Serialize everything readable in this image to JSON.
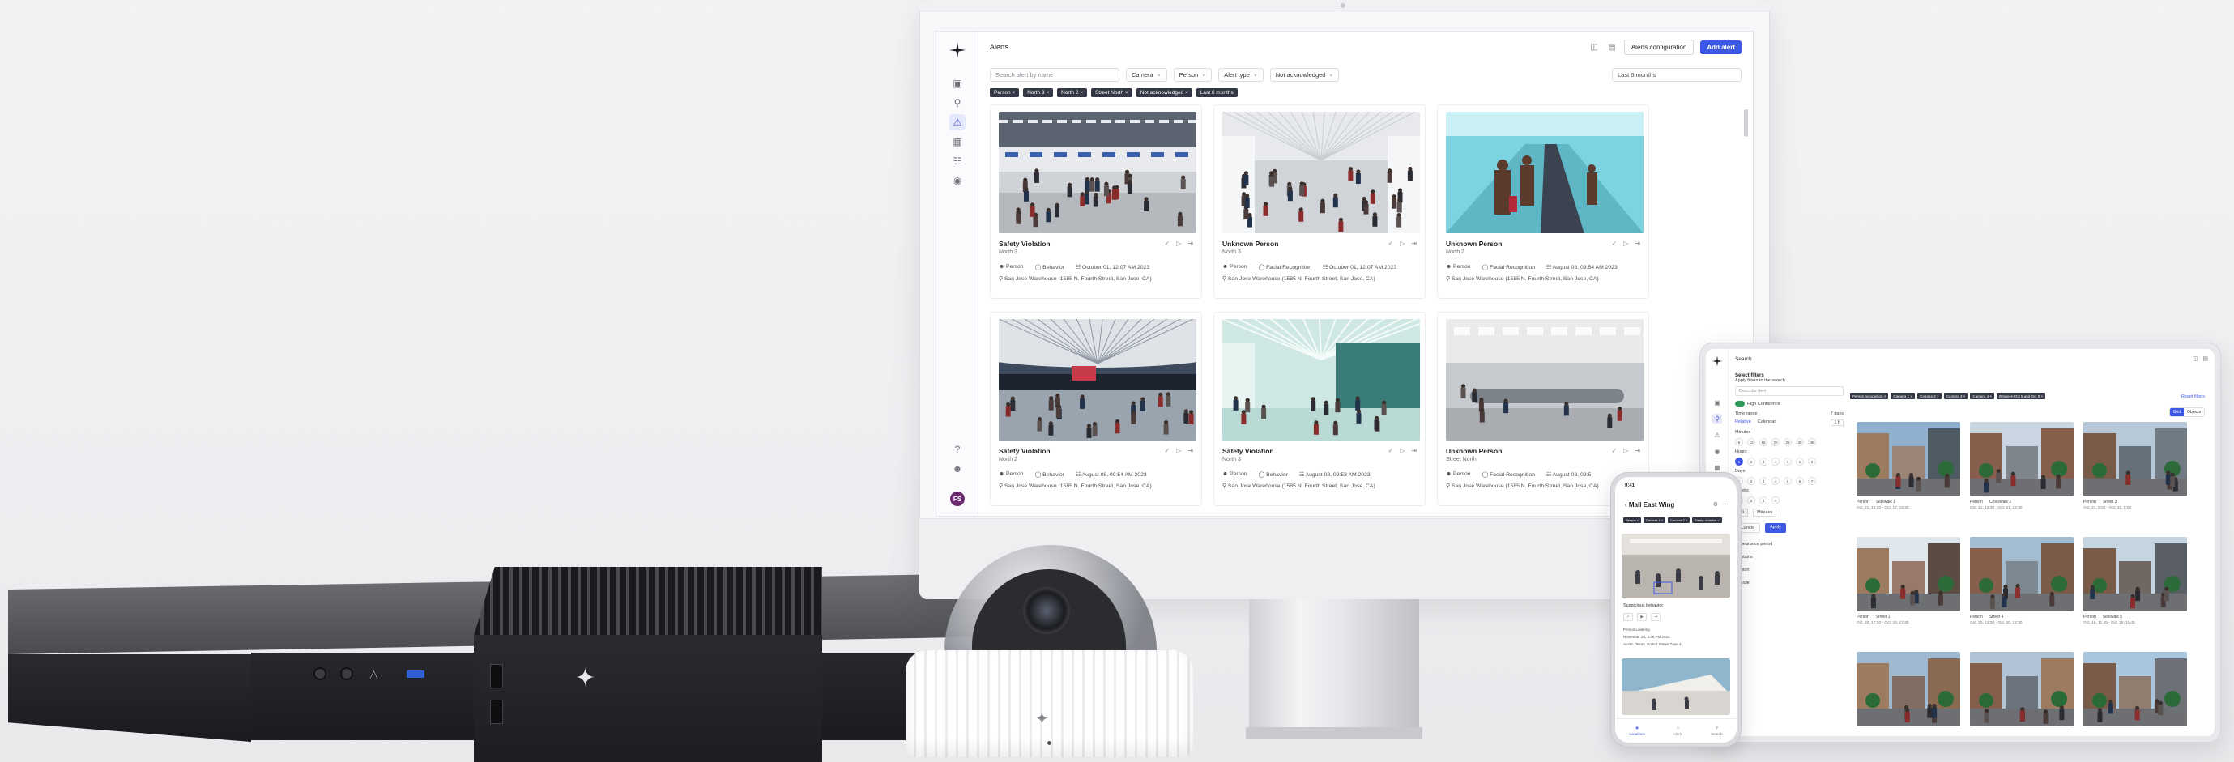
{
  "monitor": {
    "breadcrumb": "Alerts",
    "buttons": {
      "alerts_configuration": "Alerts configuration",
      "add_alert": "Add alert"
    },
    "avatar_initials": "FS",
    "search_placeholder": "Search alert by name",
    "filters": [
      "Camera",
      "Person",
      "Alert type",
      "Not acknowledged"
    ],
    "date_range": "Last 6 months",
    "chips": [
      "Person ×",
      "North 3 ×",
      "North 2 ×",
      "Street North ×",
      "Not acknowledged ×",
      "Last 6 months"
    ],
    "cards": [
      {
        "title": "Safety Violation",
        "sub": "North 3",
        "type": "Person",
        "detector": "Behavior",
        "time": "October 01, 12:07 AM 2023",
        "location": "San Jose Warehouse (1585 N. Fourth Street, San Jose, CA)",
        "scene": "checkin"
      },
      {
        "title": "Unknown Person",
        "sub": "North 3",
        "type": "Person",
        "detector": "Facial Recognition",
        "time": "October 01, 12:07 AM 2023",
        "location": "San Jose Warehouse (1585 N. Fourth Street, San Jose, CA)",
        "scene": "hall"
      },
      {
        "title": "Unknown Person",
        "sub": "North 2",
        "type": "Person",
        "detector": "Facial Recognition",
        "time": "August 08, 09:54 AM 2023",
        "location": "San Jose Warehouse (1585 N. Fourth Street, San Jose, CA)",
        "scene": "walkway"
      },
      {
        "title": "Safety Violation",
        "sub": "North 2",
        "type": "Person",
        "detector": "Behavior",
        "time": "August 08, 09:54 AM 2023",
        "location": "San Jose Warehouse (1585 N. Fourth Street, San Jose, CA)",
        "scene": "terminal"
      },
      {
        "title": "Safety Violation",
        "sub": "North 3",
        "type": "Person",
        "detector": "Behavior",
        "time": "August 08, 09:53 AM 2023",
        "location": "San Jose Warehouse (1585 N. Fourth Street, San Jose, CA)",
        "scene": "atrium"
      },
      {
        "title": "Unknown Person",
        "sub": "Street North",
        "type": "Person",
        "detector": "Facial Recognition",
        "time": "August 08, 09:5",
        "location": "San Jose Warehouse (1585 N. Fourth Street, San Jose, CA)",
        "scene": "baggage"
      }
    ]
  },
  "tablet": {
    "search_label": "Search",
    "panel": {
      "heading": "Select filters",
      "subheading": "Apply filters to the search",
      "describe_placeholder": "Describe item",
      "confidence_label": "High Confidence",
      "time_range_label": "Time range",
      "time_range_value": "7 days",
      "tabs": [
        "Relative",
        "Calendar"
      ],
      "dropdown": "1 h",
      "minutes_label": "Minutes",
      "minutes": [
        "5",
        "10",
        "15",
        "20",
        "25",
        "30",
        "45"
      ],
      "hours_label": "Hours",
      "hours": [
        "1",
        "2",
        "3",
        "4",
        "5",
        "6",
        "8"
      ],
      "days_label": "Days",
      "days": [
        "1",
        "2",
        "3",
        "4",
        "5",
        "6",
        "7"
      ],
      "weeks_label": "Weeks",
      "weeks": [
        "1",
        "2",
        "3",
        "4"
      ],
      "custom_value": "30",
      "custom_unit": "Minutes",
      "cancel": "Cancel",
      "apply": "Apply",
      "sections": [
        "Appearance period",
        "Contains",
        "Person",
        "Vehicle"
      ]
    },
    "chips": [
      "Person recognition ×",
      "Camera 1 ×",
      "Camera 2 ×",
      "Camera 3 ×",
      "Camera 4 ×",
      "Between Oct 5 and Oct 8 ×"
    ],
    "reset": "Reset filters",
    "view_switch": [
      "Grid",
      "Objects"
    ],
    "results": [
      {
        "type": "Person",
        "camera": "Sidewalk 1",
        "time": "Oct. 21, 16:30 - Oct. 17, 16:30",
        "scene": "street1"
      },
      {
        "type": "Person",
        "camera": "Crosswalk 2",
        "time": "Oct. 21, 12:30 - Oct. 21, 12:30",
        "scene": "street2"
      },
      {
        "type": "Person",
        "camera": "Street 3",
        "time": "Oct. 21, 8:00 - Oct. 21, 8:00",
        "scene": "street3"
      },
      {
        "type": "Person",
        "camera": "Street 1",
        "time": "Oct. 20, 17:30 - Oct. 20, 17:30",
        "scene": "street4"
      },
      {
        "type": "Person",
        "camera": "Street 4",
        "time": "Oct. 20, 12:30 - Oct. 20, 12:30",
        "scene": "street5"
      },
      {
        "type": "Person",
        "camera": "Sidewalk 5",
        "time": "Oct. 19, 11:45 - Oct. 19, 11:45",
        "scene": "street6"
      },
      {
        "type": "",
        "camera": "",
        "time": "",
        "scene": "street7"
      },
      {
        "type": "",
        "camera": "",
        "time": "",
        "scene": "street8"
      },
      {
        "type": "",
        "camera": "",
        "time": "",
        "scene": "street9"
      }
    ]
  },
  "phone": {
    "time": "9:41",
    "title": "Mall East Wing",
    "chips": [
      "Person ×",
      "Camera 1 ×",
      "Camera 2 ×",
      "Safety violation ×"
    ],
    "label": "Suspicious behavior",
    "actions": [
      "✓",
      "▶",
      "⇥"
    ],
    "meta": [
      "Person   Loitering",
      "November 28, 4:48 PM 2023",
      "Austin, Texas, United States   Zone 4"
    ],
    "nav": [
      "Locations",
      "Alerts",
      "Search"
    ]
  },
  "colors": {
    "accent": "#3d57e6",
    "chip_bg": "#343846",
    "brand_dark": "#1d1e24"
  }
}
